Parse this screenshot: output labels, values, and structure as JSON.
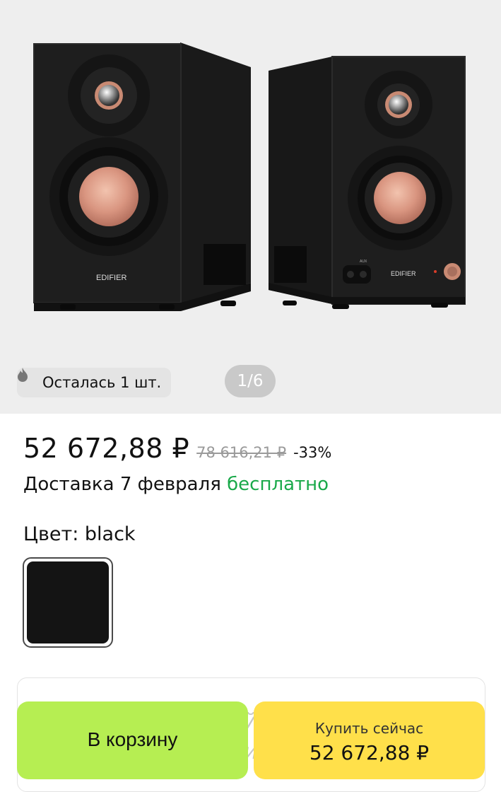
{
  "gallery": {
    "image_alt": "Edifier speakers",
    "brand_left": "EDIFIER",
    "brand_right": "EDIFIER",
    "port_left": "Ω",
    "port_right": "AUX",
    "stock_icon": "fire-icon",
    "stock_text": "Осталась 1 шт.",
    "counter": "1/6"
  },
  "price": {
    "current": "52 672,88 ₽",
    "old": "78 616,21 ₽",
    "discount": "-33%"
  },
  "delivery": {
    "text": "Доставка 7 февраля",
    "free": "бесплатно"
  },
  "color": {
    "label": "Цвет: black",
    "swatch_color": "#141414"
  },
  "panel": {
    "peek1": "й",
    "peek2": "и"
  },
  "actions": {
    "cart_label": "В корзину",
    "buy_label": "Купить сейчас",
    "buy_price": "52 672,88 ₽",
    "cart_color": "#b6ee52",
    "buy_color": "#ffe04a"
  }
}
